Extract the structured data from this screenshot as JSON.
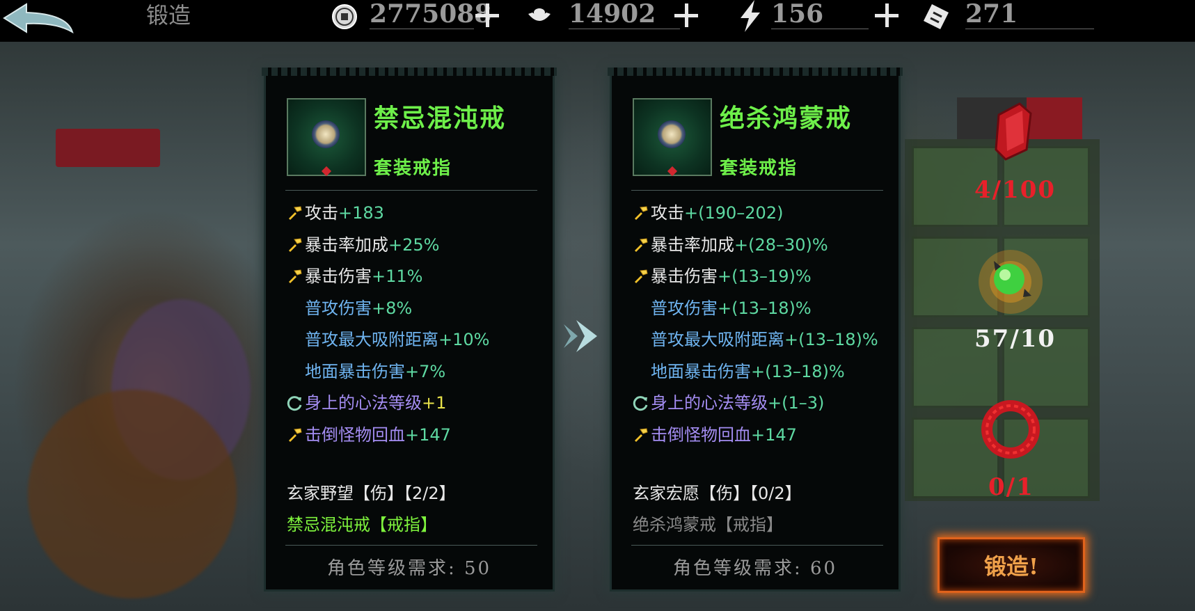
{
  "header": {
    "title": "锻造",
    "resources": [
      {
        "icon": "coin-icon",
        "value": "2775088"
      },
      {
        "icon": "ingot-icon",
        "value": "14902"
      },
      {
        "icon": "lightning-icon",
        "value": "156"
      },
      {
        "icon": "ticket-icon",
        "value": "271"
      }
    ]
  },
  "current_item": {
    "name": "禁忌混沌戒",
    "type": "套装戒指",
    "stats": [
      {
        "icon": "hammer-icon",
        "label": "攻击",
        "value": "+183",
        "label_color": "w",
        "value_color": "g"
      },
      {
        "icon": "hammer-icon",
        "label": "暴击率加成",
        "value": "+25%",
        "label_color": "w",
        "value_color": "g"
      },
      {
        "icon": "hammer-icon",
        "label": "暴击伤害",
        "value": "+11%",
        "label_color": "w",
        "value_color": "g"
      },
      {
        "icon": "",
        "label": "普攻伤害",
        "value": "+8%",
        "label_color": "b",
        "value_color": "g"
      },
      {
        "icon": "",
        "label": "普攻最大吸附距离",
        "value": "+10%",
        "label_color": "b",
        "value_color": "g"
      },
      {
        "icon": "",
        "label": "地面暴击伤害",
        "value": "+7%",
        "label_color": "b",
        "value_color": "g"
      },
      {
        "icon": "refresh-icon",
        "label": "身上的心法等级",
        "value": "+1",
        "label_color": "p",
        "value_color": "y"
      },
      {
        "icon": "hammer-icon",
        "label": "击倒怪物回血",
        "value": "+147",
        "label_color": "p",
        "value_color": "g"
      }
    ],
    "set_name": "玄家野望【伤】【2/2】",
    "set_piece": "禁忌混沌戒【戒指】",
    "level_req": "角色等级需求: 50"
  },
  "target_item": {
    "name": "绝杀鸿蒙戒",
    "type": "套装戒指",
    "stats": [
      {
        "icon": "hammer-icon",
        "label": "攻击",
        "value": "+(190–202)",
        "label_color": "w",
        "value_color": "g"
      },
      {
        "icon": "hammer-icon",
        "label": "暴击率加成",
        "value": "+(28–30)%",
        "label_color": "w",
        "value_color": "g"
      },
      {
        "icon": "hammer-icon",
        "label": "暴击伤害",
        "value": "+(13–19)%",
        "label_color": "w",
        "value_color": "g"
      },
      {
        "icon": "",
        "label": "普攻伤害",
        "value": "+(13–18)%",
        "label_color": "b",
        "value_color": "g"
      },
      {
        "icon": "",
        "label": "普攻最大吸附距离",
        "value": "+(13–18)%",
        "label_color": "b",
        "value_color": "g"
      },
      {
        "icon": "",
        "label": "地面暴击伤害",
        "value": "+(13–18)%",
        "label_color": "b",
        "value_color": "g"
      },
      {
        "icon": "refresh-icon",
        "label": "身上的心法等级",
        "value": "+(1–3)",
        "label_color": "p",
        "value_color": "g"
      },
      {
        "icon": "hammer-icon",
        "label": "击倒怪物回血",
        "value": "+147",
        "label_color": "p",
        "value_color": "g"
      }
    ],
    "set_name": "玄家宏愿【伤】【0/2】",
    "set_piece": "绝杀鸿蒙戒【戒指】",
    "level_req": "角色等级需求: 60"
  },
  "materials": [
    {
      "icon": "red-book-icon",
      "count": "4/100",
      "color": "#e8202a"
    },
    {
      "icon": "green-orb-icon",
      "count": "57/10",
      "color": "#f2f2f2"
    },
    {
      "icon": "red-ring-icon",
      "count": "0/1",
      "color": "#e8202a"
    }
  ],
  "forge_button": "锻造!"
}
